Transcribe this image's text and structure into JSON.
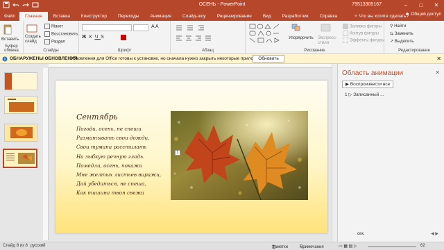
{
  "window": {
    "title": "ОСЕНЬ  -  PowerPoint",
    "user": "79513305167",
    "controls": [
      "–",
      "□",
      "✕"
    ]
  },
  "tabs": {
    "items": [
      "Файл",
      "Главная",
      "Вставка",
      "Конструктор",
      "Переходы",
      "Анимация",
      "Слайд-шоу",
      "Рецензирование",
      "Вид",
      "Разработчик",
      "Справка"
    ],
    "tell_me": "Что вы хотите сделать?",
    "share": "Общий доступ"
  },
  "ribbon": {
    "clipboard": {
      "label": "Буфер обмена",
      "paste": "Вставить"
    },
    "slides": {
      "label": "Слайды",
      "new_slide": "Создать слайд",
      "layout": "Макет",
      "reset": "Восстановить",
      "section": "Раздел"
    },
    "font": {
      "label": "Шрифт"
    },
    "paragraph": {
      "label": "Абзац"
    },
    "drawing": {
      "label": "Рисование",
      "arrange": "Упорядочить",
      "express_styles": "Экспресс-стили",
      "fill": "Заливка фигуры",
      "outline": "Контур фигуры",
      "effects": "Эффекты фигуры"
    },
    "editing": {
      "label": "Редактирование",
      "find": "Найти",
      "replace": "Заменить",
      "select": "Выделить"
    }
  },
  "notice": {
    "title": "ОБНАРУЖЕНЫ ОБНОВЛЕНИЯ",
    "message": "Обновления для Office готовы к установке, но сначала нужно закрыть некоторые приложения.",
    "button": "Обновить"
  },
  "thumbnails": {
    "numbers": [
      "5",
      "6",
      "7",
      "8"
    ]
  },
  "slide": {
    "title": "Сентябрь",
    "lines": [
      "Погоди, осень, не спеши",
      "Разматывать свои дожди,",
      "Свои тумана расстилать",
      "На зыбкую речную гладь.",
      "Помедли, осень, покажи",
      "Мне желтых листьев виражи,",
      "Дай убедиться, не спеша,",
      "Как тишина твоя свежа"
    ],
    "animation_tag": "1"
  },
  "animation_pane": {
    "title": "Область анимации",
    "play_all": "Воспроизвести все",
    "item_number": "1",
    "item_label": "Записанный ...",
    "seconds": "сек."
  },
  "status": {
    "slide": "Слайд 8 из 8",
    "language": "русский",
    "notes": "Заметки",
    "comments": "Примечания",
    "zoom": "62"
  },
  "colors": {
    "accent": "#b7472a",
    "pane_title": "#c5502a",
    "poem_text": "#4a2b14"
  }
}
